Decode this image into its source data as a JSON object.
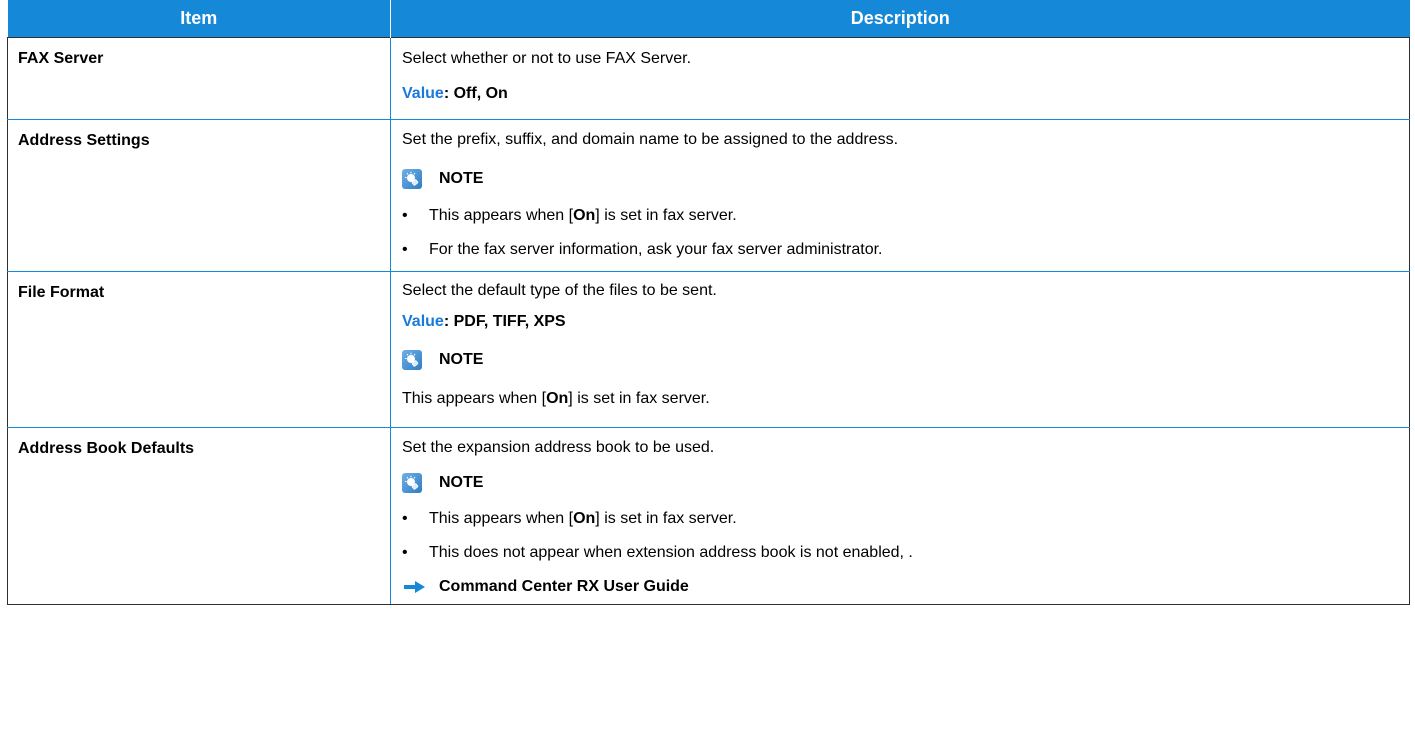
{
  "table": {
    "headers": {
      "item": "Item",
      "description": "Description"
    },
    "rows": [
      {
        "item": "FAX Server",
        "text": "Select whether or not to use FAX Server.",
        "value_label": "Value",
        "value_text": ": Off, On"
      },
      {
        "item": "Address Settings",
        "text": "Set the prefix, suffix, and domain name to be assigned to the address.",
        "note_label": "NOTE",
        "bullets": [
          {
            "before": "This appears when [",
            "keyword": "On",
            "after": "] is set in fax server."
          },
          {
            "text": "For the fax server information, ask your fax server administrator."
          }
        ]
      },
      {
        "item": "File Format",
        "text": "Select the default type of the files to be sent.",
        "value_label": "Value",
        "value_text": ": PDF, TIFF, XPS",
        "note_label": "NOTE",
        "note_before": "This appears when [",
        "note_keyword": "On",
        "note_after": "] is set in fax server."
      },
      {
        "item": "Address Book Defaults",
        "text": "Set the expansion address book to be used.",
        "note_label": "NOTE",
        "bullets": [
          {
            "before": "This appears when [",
            "keyword": "On",
            "after": "] is set in fax server."
          },
          {
            "text": "This does not appear when extension address book is not enabled, ."
          }
        ],
        "reference": "Command Center RX User Guide"
      }
    ]
  },
  "colors": {
    "header_bg": "#1688d8",
    "value_label": "#1a7ad9",
    "reference_arrow": "#1688d8"
  },
  "icons": {
    "note": "note-lightbulb-icon",
    "reference": "right-arrow-icon"
  }
}
